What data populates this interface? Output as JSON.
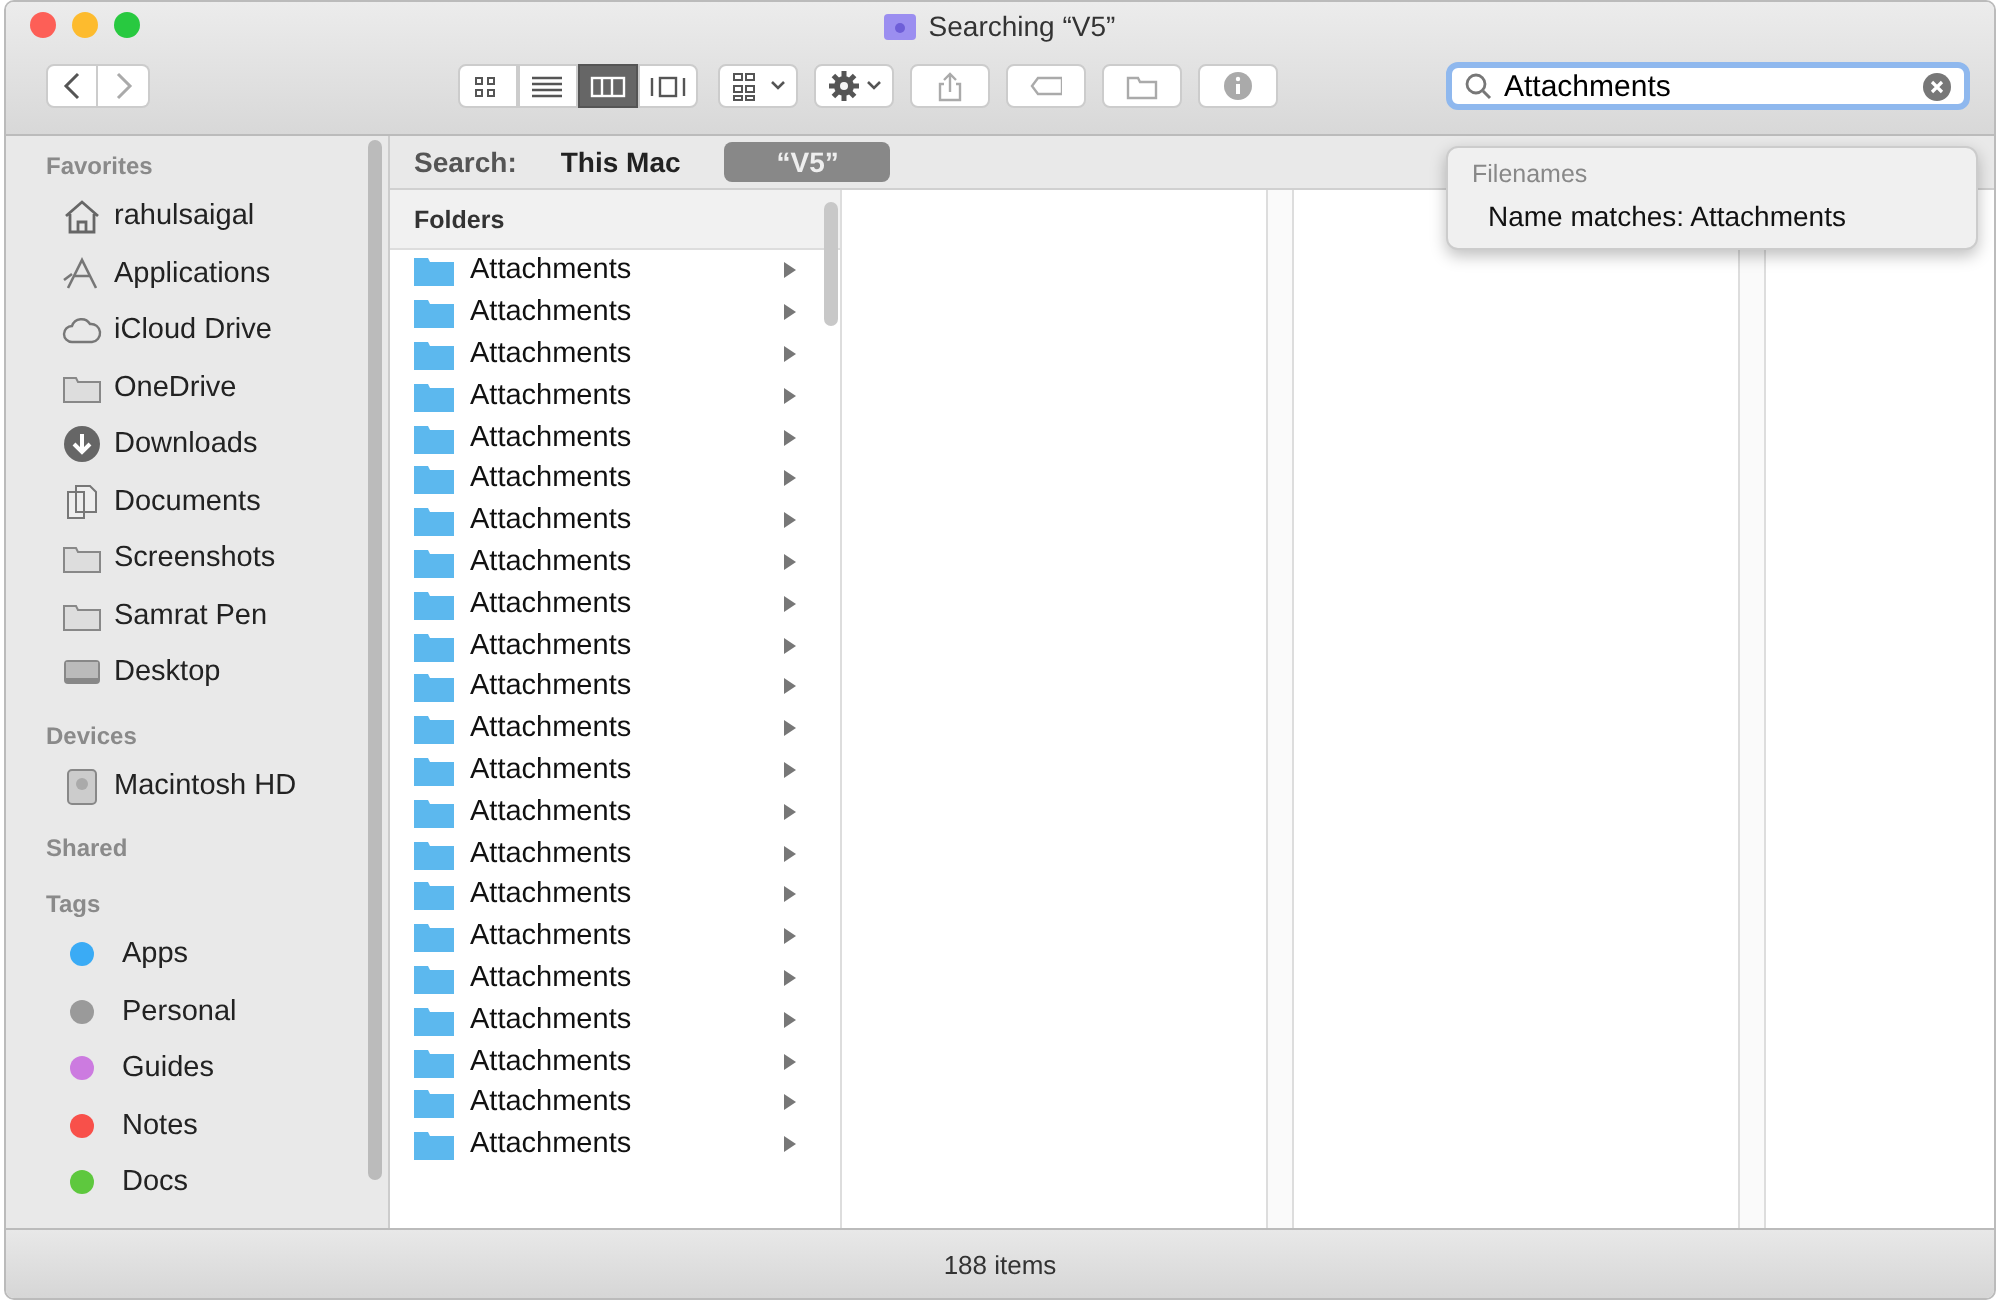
{
  "window": {
    "title": "Searching “V5”"
  },
  "toolbar": {
    "view_modes": [
      {
        "kind": "icons",
        "selected": false
      },
      {
        "kind": "list",
        "selected": false
      },
      {
        "kind": "columns",
        "selected": true
      },
      {
        "kind": "gallery",
        "selected": false
      }
    ],
    "actions": [
      {
        "kind": "arrange"
      },
      {
        "kind": "gear"
      },
      {
        "kind": "share"
      },
      {
        "kind": "tag"
      },
      {
        "kind": "new-folder"
      },
      {
        "kind": "info"
      }
    ],
    "search": {
      "value": "Attachments"
    }
  },
  "search_suggestions": {
    "heading": "Filenames",
    "items": [
      "Name matches: Attachments"
    ]
  },
  "scope_bar": {
    "label": "Search:",
    "scopes": [
      {
        "label": "This Mac",
        "selected": false
      },
      {
        "label": "“V5”",
        "selected": true
      }
    ]
  },
  "sidebar": {
    "sections": [
      {
        "title": "Favorites",
        "items": [
          {
            "label": "rahulsaigal",
            "kind": "home"
          },
          {
            "label": "Applications",
            "kind": "apps"
          },
          {
            "label": "iCloud Drive",
            "kind": "cloud"
          },
          {
            "label": "OneDrive",
            "kind": "folder"
          },
          {
            "label": "Downloads",
            "kind": "download"
          },
          {
            "label": "Documents",
            "kind": "documents"
          },
          {
            "label": "Screenshots",
            "kind": "folder"
          },
          {
            "label": "Samrat Pen",
            "kind": "folder"
          },
          {
            "label": "Desktop",
            "kind": "desktop"
          }
        ]
      },
      {
        "title": "Devices",
        "items": [
          {
            "label": "Macintosh HD",
            "kind": "disk"
          }
        ]
      },
      {
        "title": "Shared"
      },
      {
        "title": "Tags",
        "items": [
          {
            "label": "Apps",
            "kind": "tag",
            "color": "#3aabf5"
          },
          {
            "label": "Personal",
            "kind": "tag",
            "color": "#9a9a9a"
          },
          {
            "label": "Guides",
            "kind": "tag",
            "color": "#cc7be0"
          },
          {
            "label": "Notes",
            "kind": "tag",
            "color": "#f8504a"
          },
          {
            "label": "Docs",
            "kind": "tag",
            "color": "#5ec83e"
          }
        ]
      }
    ]
  },
  "results": {
    "heading": "Folders",
    "rows": [
      "Attachments",
      "Attachments",
      "Attachments",
      "Attachments",
      "Attachments",
      "Attachments",
      "Attachments",
      "Attachments",
      "Attachments",
      "Attachments",
      "Attachments",
      "Attachments",
      "Attachments",
      "Attachments",
      "Attachments",
      "Attachments",
      "Attachments",
      "Attachments",
      "Attachments",
      "Attachments",
      "Attachments",
      "Attachments"
    ]
  },
  "status_bar": {
    "text": "188 items"
  }
}
